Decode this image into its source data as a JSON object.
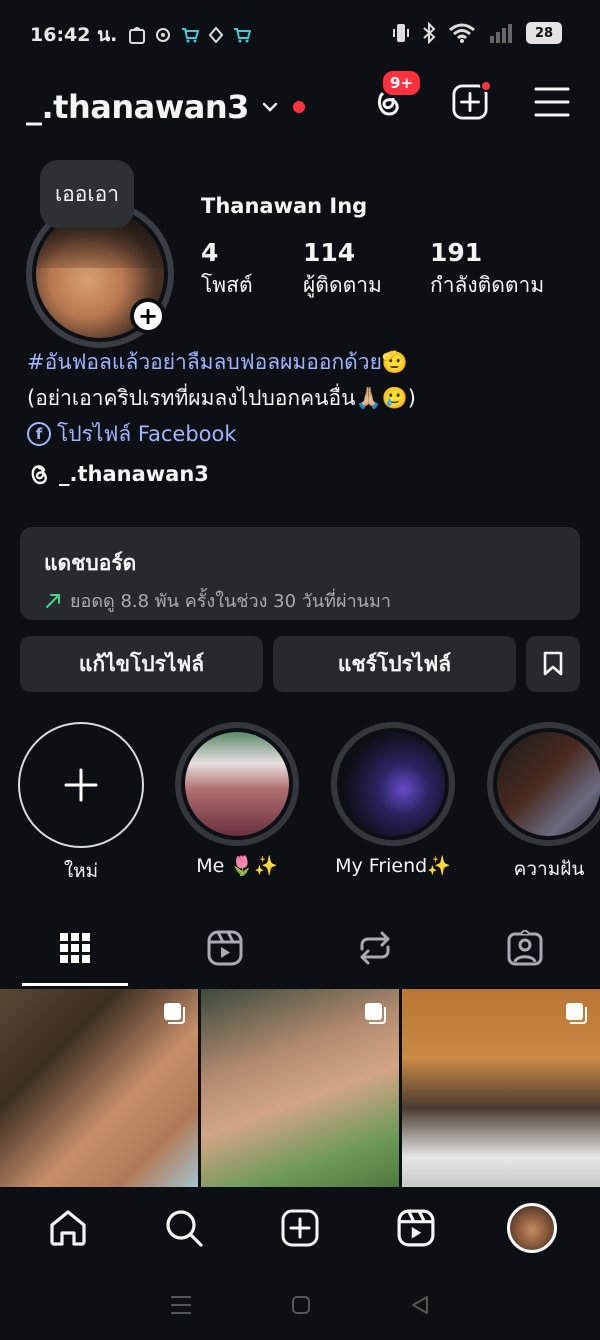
{
  "status_bar": {
    "time": "16:42 น.",
    "battery": "28"
  },
  "header": {
    "username": "_.thanawan3",
    "threads_badge": "9+"
  },
  "profile": {
    "note": "เออเอา",
    "display_name": "Thanawan Ing",
    "stats": [
      {
        "value": "4",
        "label": "โพสต์"
      },
      {
        "value": "114",
        "label": "ผู้ติดตาม"
      },
      {
        "value": "191",
        "label": "กำลังติดตาม"
      }
    ],
    "bio_hashtag": "#อันฟอลแล้วอย่าลืมลบฟอลผมออกด้วย🫡",
    "bio_line2": "(อย่าเอาคริปเรทที่ผมลงไปบอกคนอื่น🙏🏼🥲)",
    "facebook_link": "โปรไฟล์ Facebook",
    "threads_handle": "_.thanawan3"
  },
  "dashboard": {
    "title": "แดชบอร์ด",
    "subtitle": "ยอดดู 8.8 พัน ครั้งในช่วง 30 วันที่ผ่านมา"
  },
  "buttons": {
    "edit_profile": "แก้ไขโปรไฟล์",
    "share_profile": "แชร์โปรไฟล์"
  },
  "highlights": [
    {
      "label": "ใหม่"
    },
    {
      "label": "Me 🌷✨"
    },
    {
      "label": "My Friend✨"
    },
    {
      "label": "ความฝัน"
    }
  ],
  "colors": {
    "background": "#0c1015",
    "surface": "#262a2f",
    "accent_link": "#a0b4ff",
    "notification": "#ff3040"
  }
}
